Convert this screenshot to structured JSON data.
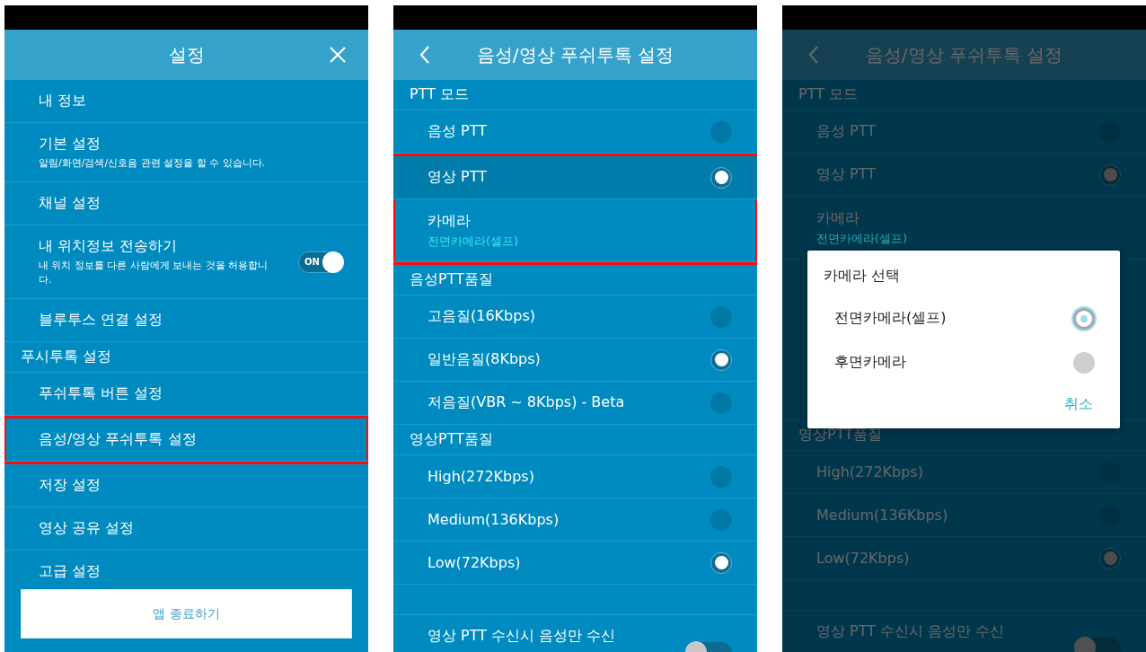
{
  "screens": [
    {
      "header": {
        "title": "설정",
        "close": true
      },
      "rows": [
        {
          "kind": "item",
          "label": "내 정보",
          "highlighted": false
        },
        {
          "kind": "item",
          "label": "기본 설정",
          "subtitle": "알림/화면/검색/신호음 관련 설정을 할 수 있습니다.",
          "highlighted": false
        },
        {
          "kind": "item",
          "label": "채널 설정",
          "highlighted": false
        },
        {
          "kind": "toggle",
          "label": "내 위치정보 전송하기",
          "subtitle": "내 위치 정보를 다른 사람에게 보내는 것을 허용합니다.",
          "toggle": {
            "label": "ON",
            "on": true
          },
          "highlighted": false
        },
        {
          "kind": "item",
          "label": "블루투스 연결 설정",
          "highlighted": false
        },
        {
          "kind": "section",
          "label": "푸시투톡 설정",
          "highlighted": false
        },
        {
          "kind": "item",
          "label": "푸쉬투톡 버튼 설정",
          "highlighted": false
        },
        {
          "kind": "item",
          "label": "음성/영상 푸쉬투톡 설정",
          "highlighted": true
        },
        {
          "kind": "item",
          "label": "저장 설정",
          "highlighted": false
        },
        {
          "kind": "item",
          "label": "영상 공유 설정",
          "highlighted": false
        },
        {
          "kind": "item",
          "label": "고급 설정",
          "highlighted": false
        }
      ],
      "footer_button": "앱 종료하기"
    },
    {
      "header": {
        "title": "음성/영상 푸쉬투톡 설정",
        "back": true
      },
      "rows": [
        {
          "kind": "section",
          "label": "PTT 모드",
          "highlighted": false
        },
        {
          "kind": "radio",
          "label": "음성 PTT",
          "selected": false,
          "pressed": false,
          "highlighted": false
        },
        {
          "kind": "radio",
          "label": "영상 PTT",
          "selected": true,
          "pressed": true,
          "highlighted": true
        },
        {
          "kind": "value",
          "label": "카메라",
          "value": "전면카메라(셀프)",
          "highlighted": true
        },
        {
          "kind": "section",
          "label": "음성PTT품질",
          "highlighted": false
        },
        {
          "kind": "radio",
          "label": "고음질(16Kbps)",
          "selected": false,
          "pressed": false,
          "highlighted": false
        },
        {
          "kind": "radio",
          "label": "일반음질(8Kbps)",
          "selected": true,
          "pressed": false,
          "highlighted": false
        },
        {
          "kind": "radio",
          "label": "저음질(VBR ~ 8Kbps) - Beta",
          "selected": false,
          "pressed": false,
          "highlighted": false
        },
        {
          "kind": "section",
          "label": "영상PTT품질",
          "highlighted": false
        },
        {
          "kind": "radio",
          "label": "High(272Kbps)",
          "selected": false,
          "pressed": false,
          "highlighted": false
        },
        {
          "kind": "radio",
          "label": "Medium(136Kbps)",
          "selected": false,
          "pressed": false,
          "highlighted": false
        },
        {
          "kind": "radio",
          "label": "Low(72Kbps)",
          "selected": true,
          "pressed": false,
          "highlighted": false
        },
        {
          "kind": "spacer",
          "highlighted": false
        },
        {
          "kind": "toggle",
          "label": "영상 PTT 수신시 음성만 수신",
          "toggle": {
            "on": false
          },
          "highlighted": false
        }
      ]
    },
    {
      "header": {
        "title": "음성/영상 푸쉬투톡 설정",
        "back": true
      },
      "dimmed": true,
      "rows": [
        {
          "kind": "section",
          "label": "PTT 모드"
        },
        {
          "kind": "radio",
          "label": "음성 PTT",
          "selected": false
        },
        {
          "kind": "radio",
          "label": "영상 PTT",
          "selected": true
        },
        {
          "kind": "value",
          "label": "카메라",
          "value": "전면카메라(셀프)"
        },
        {
          "kind": "covered"
        },
        {
          "kind": "section",
          "label": "영상PTT품질"
        },
        {
          "kind": "radio",
          "label": "High(272Kbps)",
          "selected": false
        },
        {
          "kind": "radio",
          "label": "Medium(136Kbps)",
          "selected": false
        },
        {
          "kind": "radio",
          "label": "Low(72Kbps)",
          "selected": true
        },
        {
          "kind": "spacer"
        },
        {
          "kind": "toggle",
          "label": "영상 PTT 수신시 음성만 수신",
          "toggle": {
            "on": false
          }
        }
      ],
      "dialog": {
        "title": "카메라 선택",
        "options": [
          {
            "label": "전면카메라(셀프)",
            "selected": true
          },
          {
            "label": "후면카메라",
            "selected": false
          }
        ],
        "cancel": "취소"
      }
    }
  ]
}
